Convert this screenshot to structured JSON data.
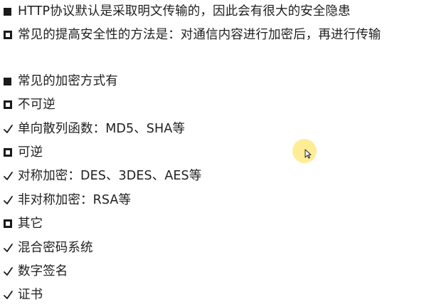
{
  "lines": [
    {
      "marker": "filled",
      "text": "HTTP协议默认是采取明文传输的，因此会有很大的安全隐患"
    },
    {
      "marker": "hollow",
      "text": "常见的提高安全性的方法是：对通信内容进行加密后，再进行传输"
    },
    {
      "marker": "filled",
      "text": "常见的加密方式有"
    },
    {
      "marker": "hollow",
      "text": "不可逆"
    },
    {
      "marker": "check",
      "text": "单向散列函数：MD5、SHA等"
    },
    {
      "marker": "hollow",
      "text": "可逆"
    },
    {
      "marker": "check",
      "text": "对称加密：DES、3DES、AES等"
    },
    {
      "marker": "check",
      "text": "非对称加密：RSA等"
    },
    {
      "marker": "hollow",
      "text": "其它"
    },
    {
      "marker": "check",
      "text": "混合密码系统"
    },
    {
      "marker": "check",
      "text": "数字签名"
    },
    {
      "marker": "check",
      "text": "证书"
    }
  ],
  "icons": {
    "filled": "filled-square-bullet-icon",
    "hollow": "hollow-square-bullet-icon",
    "check": "checkmark-icon",
    "cursor": "mouse-pointer-icon"
  },
  "colors": {
    "text": "#1f1f1f",
    "marker": "#1a1a1a",
    "cursor_halo": "#ffe66e"
  }
}
